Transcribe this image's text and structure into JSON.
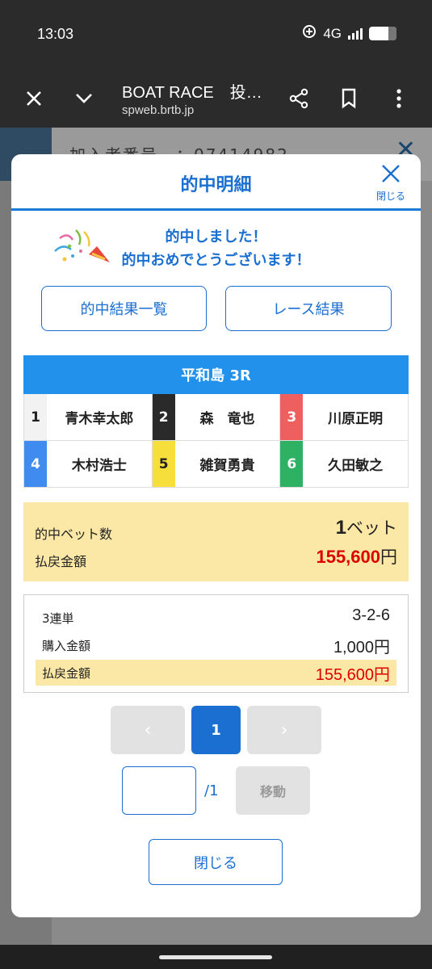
{
  "status": {
    "time": "13:03",
    "network": "4G"
  },
  "browser": {
    "title": "BOAT RACE　投…",
    "url": "spweb.brtb.jp"
  },
  "background": {
    "header_text": "加入者番号　：07414982"
  },
  "modal": {
    "title": "的中明細",
    "close_label": "閉じる",
    "congrats_line1": "的中しました！",
    "congrats_line2": "的中おめでとうございます！",
    "btn_results_list": "的中結果一覧",
    "btn_race_results": "レース結果",
    "race_title": "平和島 3R",
    "racers": [
      {
        "num": "1",
        "name": "青木幸太郎",
        "bg": "#f2f2f2",
        "fg": "#222222"
      },
      {
        "num": "2",
        "name": "森　竜也",
        "bg": "#2a2a2a",
        "fg": "#ffffff"
      },
      {
        "num": "3",
        "name": "川原正明",
        "bg": "#ee5f5f",
        "fg": "#ffffff"
      },
      {
        "num": "4",
        "name": "木村浩士",
        "bg": "#3f8bf0",
        "fg": "#ffffff"
      },
      {
        "num": "5",
        "name": "雑賀勇貴",
        "bg": "#f7df3b",
        "fg": "#222222"
      },
      {
        "num": "6",
        "name": "久田敏之",
        "bg": "#2fb163",
        "fg": "#ffffff"
      }
    ],
    "summary": {
      "bets_label": "的中ベット数",
      "bets_value": "1",
      "bets_unit": "ベット",
      "payout_label": "払戻金額",
      "payout_value": "155,600",
      "payout_unit": "円"
    },
    "detail": {
      "bet_type": "3連単",
      "combination": "3-2-6",
      "purchase_label": "購入金額",
      "purchase_value": "1,000円",
      "payout_label": "払戻金額",
      "payout_value": "155,600円"
    },
    "pagination": {
      "prev": "‹",
      "current": "1",
      "next": "›",
      "input_value": "",
      "total": "/1",
      "move_label": "移動"
    },
    "footer_close": "閉じる"
  },
  "colors": {
    "accent": "#1a6fd0",
    "race_bar": "#2191ec",
    "highlight": "#fbe8a6",
    "payout_red": "#dd0000"
  }
}
